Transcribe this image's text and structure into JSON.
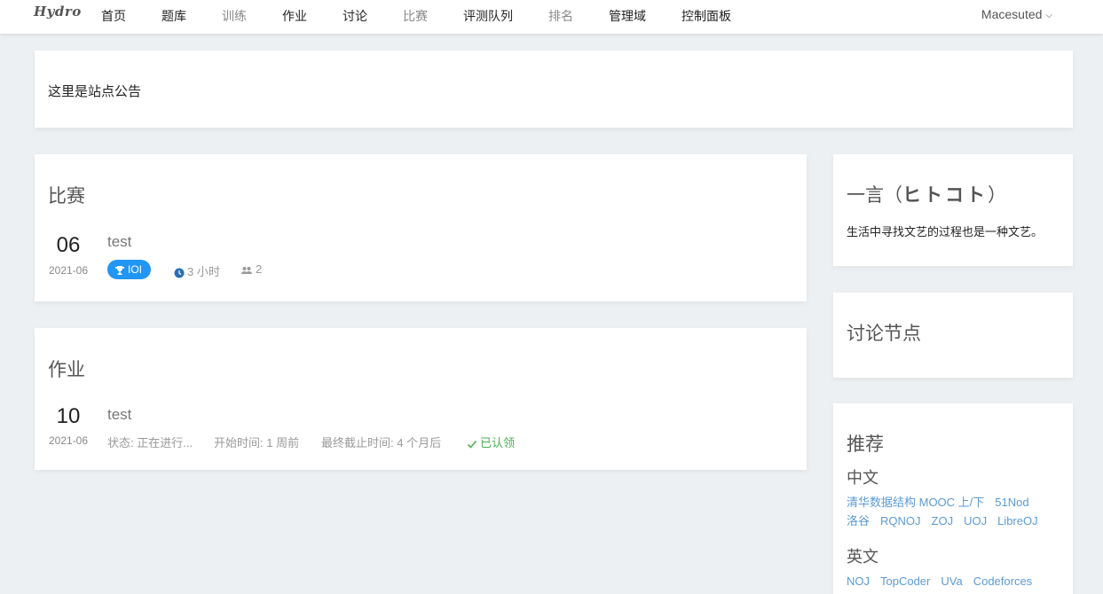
{
  "nav": {
    "logo": "Hydro",
    "items": [
      "首页",
      "题库",
      "训练",
      "作业",
      "讨论",
      "比赛",
      "评测队列",
      "排名",
      "管理域",
      "控制面板"
    ],
    "user": "Macesuted"
  },
  "notice": {
    "text": "这里是站点公告"
  },
  "contest": {
    "title": "比赛",
    "item": {
      "day": "06",
      "yearmonth": "2021-06",
      "name": "test",
      "rule": "IOI",
      "duration": "3 小时",
      "participants": "2"
    }
  },
  "homework": {
    "title": "作业",
    "item": {
      "day": "10",
      "yearmonth": "2021-06",
      "name": "test",
      "status": "状态: 正在进行...",
      "begin": "开始时间: 1 周前",
      "deadline": "最终截止时间: 4 个月后",
      "claimed": "已认领"
    }
  },
  "hitokoto": {
    "title_prefix": "一言（",
    "title_main": "ヒトコト",
    "title_suffix": "）",
    "text": "生活中寻找文艺的过程也是一种文艺。"
  },
  "discussion_nodes": {
    "title": "讨论节点"
  },
  "recommend": {
    "title": "推荐",
    "chinese": {
      "label": "中文",
      "links": [
        "清华数据结构 MOOC 上/下",
        "51Nod",
        "洛谷",
        "RQNOJ",
        "ZOJ",
        "UOJ",
        "LibreOJ"
      ]
    },
    "english": {
      "label": "英文",
      "links": [
        "NOJ",
        "TopCoder",
        "UVa",
        "Codeforces"
      ]
    }
  },
  "colors": {
    "accent": "#2196f3",
    "link": "#5b9bd5",
    "success": "#4caf50",
    "background": "#edf0f2"
  },
  "icons": {
    "rule_badge": "trophy-icon",
    "duration": "clock-icon",
    "participants": "people-icon",
    "claimed": "check-icon",
    "user_menu": "chevron-down-icon"
  }
}
